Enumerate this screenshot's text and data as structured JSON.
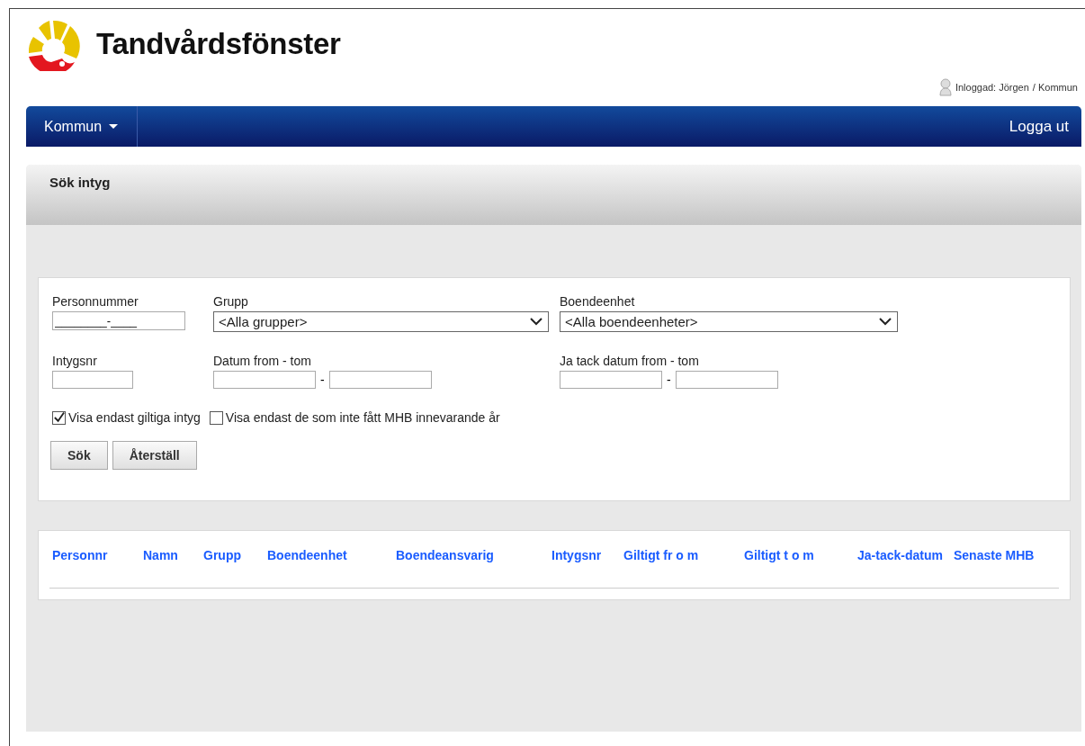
{
  "header": {
    "title": "Tandvårdsfönster",
    "user": "Inloggad: Jörgen",
    "role": "/ Kommun"
  },
  "nav": {
    "menu": "Kommun",
    "logout": "Logga ut"
  },
  "panel": {
    "title": "Sök intyg"
  },
  "form": {
    "personnummer": {
      "label": "Personnummer",
      "value": "________-____"
    },
    "grupp": {
      "label": "Grupp",
      "value": "<Alla grupper>"
    },
    "boendeenhet": {
      "label": "Boendeenhet",
      "value": "<Alla boendeenheter>"
    },
    "intygsnr": {
      "label": "Intygsnr"
    },
    "datum": {
      "label": "Datum from - tom",
      "separator": "-"
    },
    "jatack": {
      "label": "Ja tack datum from - tom",
      "separator": "-"
    },
    "checkboxes": [
      {
        "label": "Visa endast giltiga intyg",
        "checked": true
      },
      {
        "label": "Visa endast de som inte fått MHB innevarande år",
        "checked": false
      }
    ],
    "buttons": [
      "Sök",
      "Återställ"
    ]
  },
  "table": {
    "columns": [
      "Personnr",
      "Namn",
      "Grupp",
      "Boendeenhet",
      "Boendeansvarig",
      "Intygsnr",
      "Giltigt fr o m",
      "Giltigt t o m",
      "Ja-tack-datum",
      "Senaste MHB"
    ]
  }
}
